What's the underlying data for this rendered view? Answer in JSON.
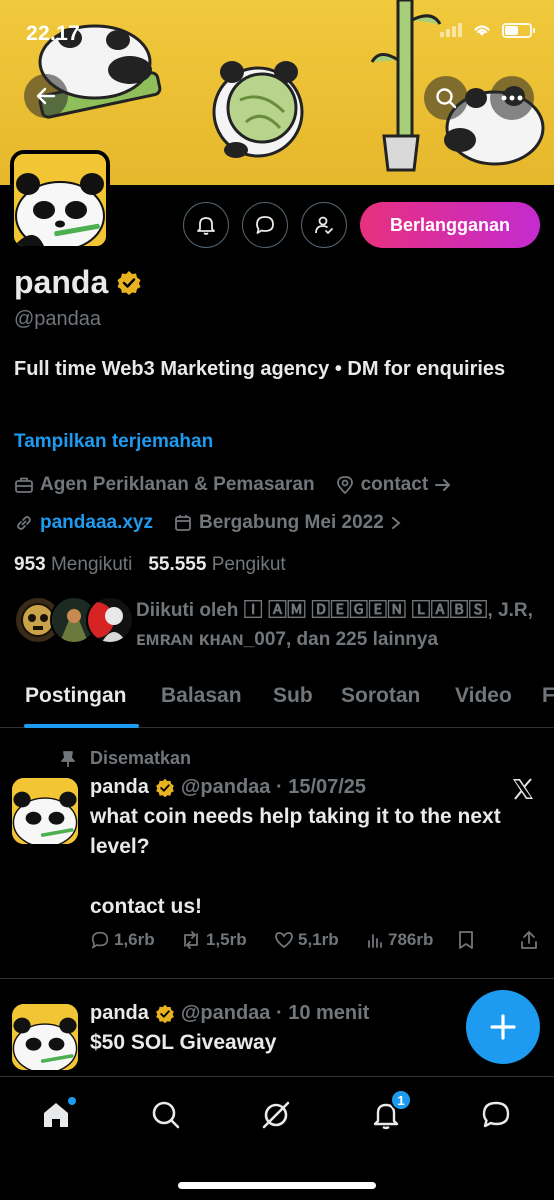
{
  "status_bar": {
    "time": "22.17"
  },
  "profile": {
    "name": "panda",
    "handle": "@pandaa",
    "bio": "Full time Web3 Marketing agency • DM for enquiries",
    "translate_link": "Tampilkan terjemahan",
    "category": "Agen Periklanan & Pemasaran",
    "location": "contact",
    "website": "pandaaa.xyz",
    "joined": "Bergabung Mei 2022",
    "following_count": "953",
    "following_label": "Mengikuti",
    "followers_count": "55.555",
    "followers_label": "Pengikut",
    "followed_by": "Diikuti oleh 🄸 🄰🄼 🄳🄴🄶🄴🄽 🄻🄰🄱🅂, J.R, ᴇᴍʀᴀɴ ᴋʜᴀɴ_007, dan 225 lainnya",
    "subscribe_label": "Berlangganan"
  },
  "tabs": [
    {
      "label": "Postingan",
      "active": true
    },
    {
      "label": "Balasan",
      "active": false
    },
    {
      "label": "Sub",
      "active": false
    },
    {
      "label": "Sorotan",
      "active": false
    },
    {
      "label": "Video",
      "active": false
    },
    {
      "label": "F",
      "active": false
    }
  ],
  "posts": [
    {
      "pinned_label": "Disematkan",
      "author": "panda",
      "meta": "@pandaa · 15/07/25",
      "text_line1": "what coin needs help taking it to the next",
      "text_line2": "level?",
      "text_line3": "contact us!",
      "replies": "1,6rb",
      "reposts": "1,5rb",
      "likes": "5,1rb",
      "views": "786rb"
    },
    {
      "author": "panda",
      "meta": "@pandaa · 10 menit",
      "text_line1": "$50 SOL Giveaway"
    }
  ],
  "nav": {
    "notifications_badge": "1"
  },
  "colors": {
    "accent": "#1d9bf0",
    "banner": "#f1c93c",
    "verified": "#e8b321"
  }
}
